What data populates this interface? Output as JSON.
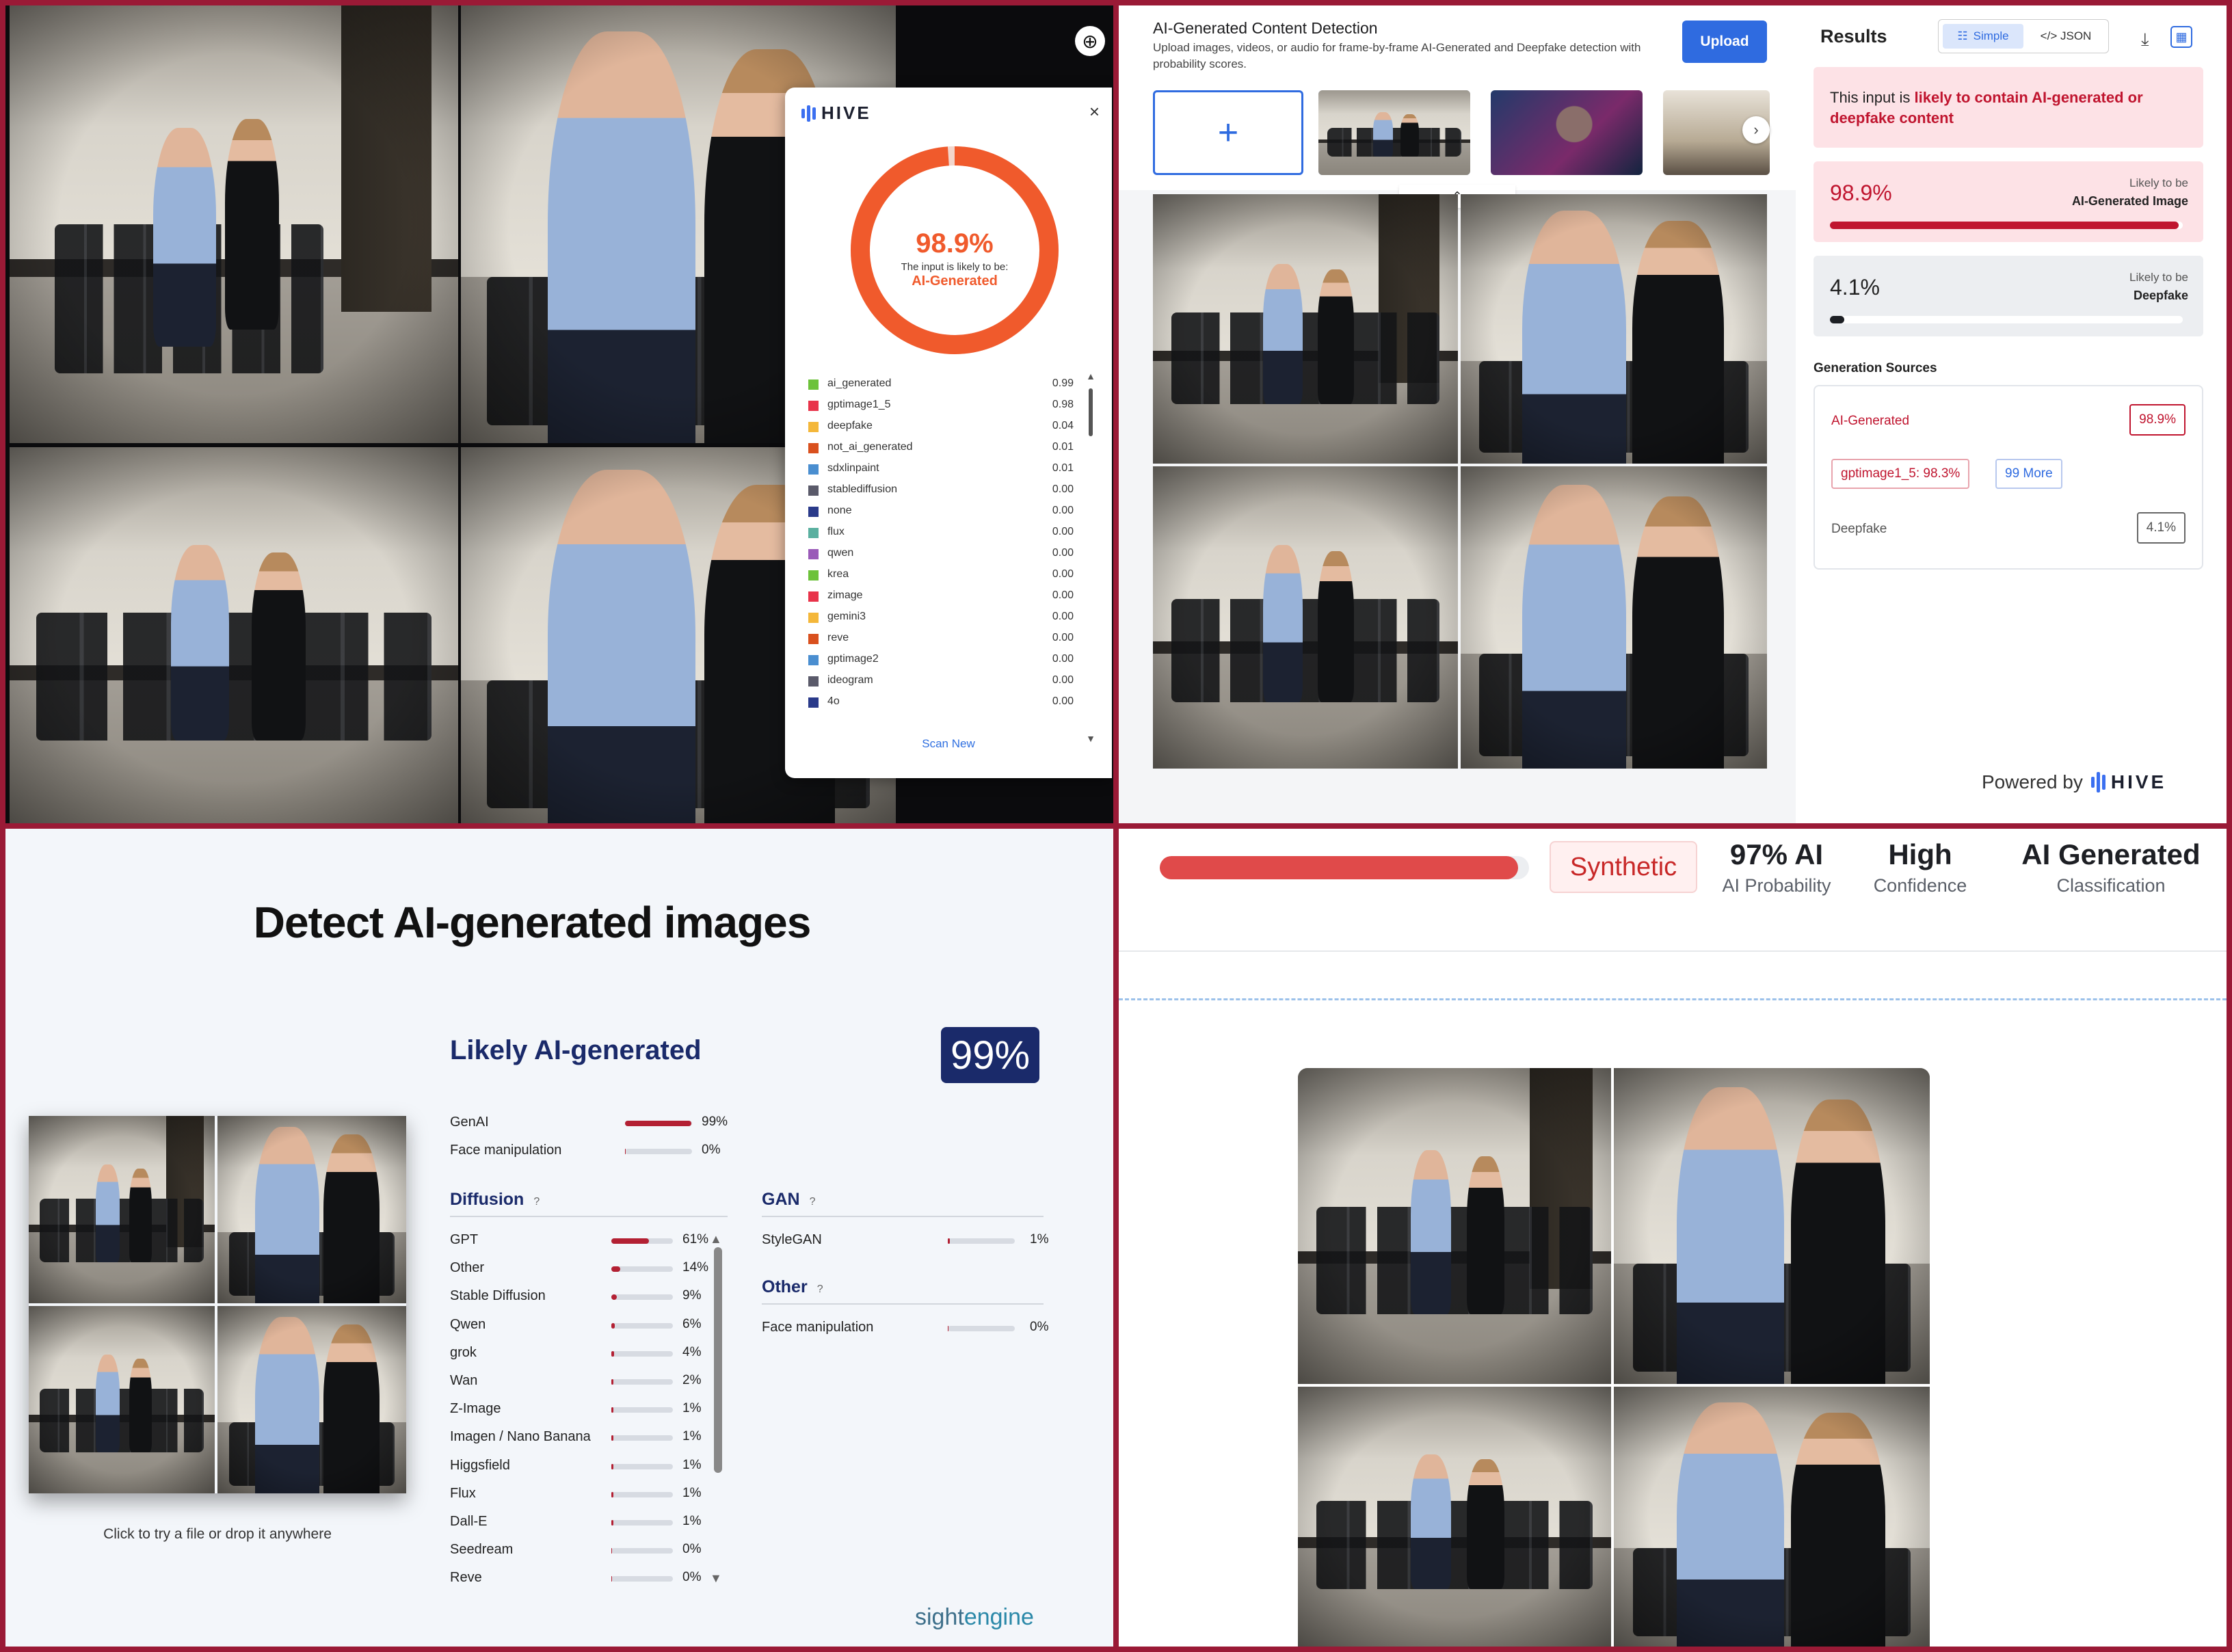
{
  "hive_popup": {
    "logo_text": "HIVE",
    "close_glyph": "×",
    "percentage": "98.9%",
    "subtitle": "The input is likely to be:",
    "result": "AI-Generated",
    "ai_fraction": 0.989,
    "scores": [
      {
        "name": "ai_generated",
        "value": "0.99",
        "color": "#6cc23a"
      },
      {
        "name": "gptimage1_5",
        "value": "0.98",
        "color": "#e8334a"
      },
      {
        "name": "deepfake",
        "value": "0.04",
        "color": "#f4b73a"
      },
      {
        "name": "not_ai_generated",
        "value": "0.01",
        "color": "#d9501e"
      },
      {
        "name": "sdxlinpaint",
        "value": "0.01",
        "color": "#4a8ed0"
      },
      {
        "name": "stablediffusion",
        "value": "0.00",
        "color": "#5a5a6a"
      },
      {
        "name": "none",
        "value": "0.00",
        "color": "#2a3a8a"
      },
      {
        "name": "flux",
        "value": "0.00",
        "color": "#5ab0a0"
      },
      {
        "name": "qwen",
        "value": "0.00",
        "color": "#9a5ab8"
      },
      {
        "name": "krea",
        "value": "0.00",
        "color": "#6cc23a"
      },
      {
        "name": "zimage",
        "value": "0.00",
        "color": "#e8334a"
      },
      {
        "name": "gemini3",
        "value": "0.00",
        "color": "#f4b73a"
      },
      {
        "name": "reve",
        "value": "0.00",
        "color": "#d9501e"
      },
      {
        "name": "gptimage2",
        "value": "0.00",
        "color": "#4a8ed0"
      },
      {
        "name": "ideogram",
        "value": "0.00",
        "color": "#5a5a6a"
      },
      {
        "name": "4o",
        "value": "0.00",
        "color": "#2a3a8a"
      }
    ],
    "scan_new": "Scan New"
  },
  "hive_app": {
    "title": "AI-Generated Content Detection",
    "description": "Upload images, videos, or audio for frame-by-frame AI-Generated and Deepfake detection with probability scores.",
    "upload_label": "Upload",
    "add_glyph": "+",
    "results_title": "Results",
    "toggle_simple": "Simple",
    "toggle_json": "</> JSON",
    "alert_prefix": "This input is ",
    "alert_highlight": "likely to contain AI-generated or deepfake content",
    "ai_card": {
      "percent": "98.9%",
      "line1": "Likely to be",
      "line2": "AI-Generated Image",
      "fraction": 0.989,
      "color": "#c0152f"
    },
    "deepfake_card": {
      "percent": "4.1%",
      "line1": "Likely to be",
      "line2": "Deepfake",
      "fraction": 0.041,
      "color": "#1d1f24"
    },
    "gen_sources_title": "Generation Sources",
    "source_ai_label": "AI-Generated",
    "source_ai_value": "98.9%",
    "chip_gpt": "gptimage1_5: 98.3%",
    "chip_more": "99 More",
    "source_deepfake_label": "Deepfake",
    "source_deepfake_value": "4.1%",
    "powered_by": "Powered by",
    "powered_brand": "HIVE"
  },
  "sightengine": {
    "title": "Detect AI-generated images",
    "verdict": "Likely AI-generated",
    "badge": "99%",
    "caption": "Click to try a file or drop it anywhere",
    "top_metrics": [
      {
        "name": "GenAI",
        "value": "99%",
        "fraction": 0.99
      },
      {
        "name": "Face manipulation",
        "value": "0%",
        "fraction": 0.0
      }
    ],
    "diffusion_title": "Diffusion",
    "help_glyph": "?",
    "diffusion": [
      {
        "name": "GPT",
        "value": "61%",
        "fraction": 0.61
      },
      {
        "name": "Other",
        "value": "14%",
        "fraction": 0.14
      },
      {
        "name": "Stable Diffusion",
        "value": "9%",
        "fraction": 0.09
      },
      {
        "name": "Qwen",
        "value": "6%",
        "fraction": 0.06
      },
      {
        "name": "grok",
        "value": "4%",
        "fraction": 0.04
      },
      {
        "name": "Wan",
        "value": "2%",
        "fraction": 0.02
      },
      {
        "name": "Z-Image",
        "value": "1%",
        "fraction": 0.01
      },
      {
        "name": "Imagen / Nano Banana",
        "value": "1%",
        "fraction": 0.01
      },
      {
        "name": "Higgsfield",
        "value": "1%",
        "fraction": 0.01
      },
      {
        "name": "Flux",
        "value": "1%",
        "fraction": 0.01
      },
      {
        "name": "Dall-E",
        "value": "1%",
        "fraction": 0.01
      },
      {
        "name": "Seedream",
        "value": "0%",
        "fraction": 0.0
      },
      {
        "name": "Reve",
        "value": "0%",
        "fraction": 0.0
      }
    ],
    "gan_title": "GAN",
    "gan": [
      {
        "name": "StyleGAN",
        "value": "1%",
        "fraction": 0.01
      }
    ],
    "other_title": "Other",
    "other": [
      {
        "name": "Face manipulation",
        "value": "0%",
        "fraction": 0.0
      }
    ],
    "brand_a": "sight",
    "brand_b": "engine"
  },
  "detector4": {
    "bar_fraction": 0.97,
    "badge": "Synthetic",
    "stats": [
      {
        "big": "97% AI",
        "small": "AI Probability"
      },
      {
        "big": "High",
        "small": "Confidence"
      },
      {
        "big": "AI Generated",
        "small": "Classification"
      }
    ]
  },
  "icons": [
    "zoom-in-icon",
    "close-icon",
    "chevron-right-icon",
    "chevron-up-icon",
    "download-icon",
    "qr-grid-icon",
    "help-icon",
    "scroll-up-icon",
    "scroll-down-icon"
  ]
}
